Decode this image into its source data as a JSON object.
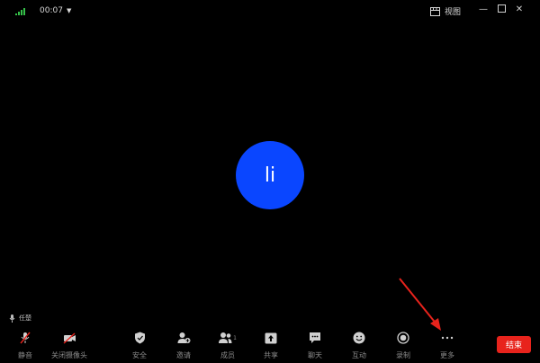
{
  "status": {
    "timer": "00:07"
  },
  "header": {
    "view_label": "视图"
  },
  "participant": {
    "avatar_initials": "li",
    "avatar_color": "#0a46ff",
    "speaker_name": "任楚"
  },
  "toolbar": {
    "mute_label": "静音",
    "camera_label": "关闭摄像头",
    "security_label": "安全",
    "invite_label": "邀请",
    "members_label": "成员",
    "members_count": "1",
    "share_label": "共享",
    "chat_label": "聊天",
    "interact_label": "互动",
    "record_label": "录制",
    "more_label": "更多",
    "end_label": "结束"
  },
  "colors": {
    "background": "#000000",
    "end_button": "#e8231c",
    "annotation_arrow": "#e8231c",
    "signal": "#36c24a"
  }
}
